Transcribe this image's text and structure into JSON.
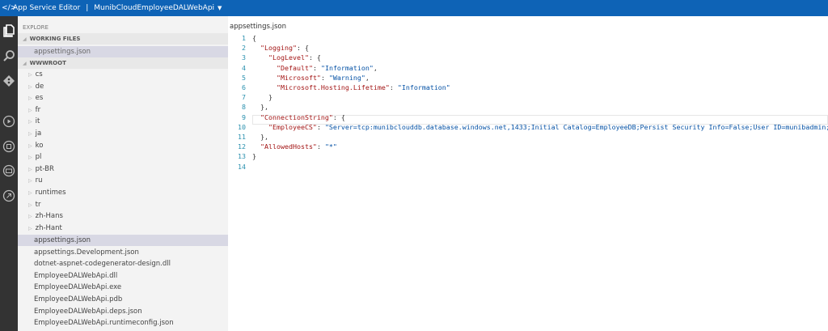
{
  "titlebar": {
    "app": "App Service Editor",
    "separator": "|",
    "site": "MunibCloudEmployeeDALWebApi"
  },
  "sidebar": {
    "explore": "EXPLORE",
    "working_files": "WORKING FILES",
    "working_items": [
      "appsettings.json"
    ],
    "root": "WWWROOT",
    "folders": [
      "cs",
      "de",
      "es",
      "fr",
      "it",
      "ja",
      "ko",
      "pl",
      "pt-BR",
      "ru",
      "runtimes",
      "tr",
      "zh-Hans",
      "zh-Hant"
    ],
    "files": [
      "appsettings.json",
      "appsettings.Development.json",
      "dotnet-aspnet-codegenerator-design.dll",
      "EmployeeDALWebApi.dll",
      "EmployeeDALWebApi.exe",
      "EmployeeDALWebApi.pdb",
      "EmployeeDALWebApi.deps.json",
      "EmployeeDALWebApi.runtimeconfig.json"
    ]
  },
  "editor": {
    "title": "appsettings.json",
    "lines": [
      [
        [
          "p",
          "{"
        ]
      ],
      [
        [
          "p",
          "  "
        ],
        [
          "k",
          "\"Logging\""
        ],
        [
          "p",
          ": {"
        ]
      ],
      [
        [
          "p",
          "    "
        ],
        [
          "k",
          "\"LogLevel\""
        ],
        [
          "p",
          ": {"
        ]
      ],
      [
        [
          "p",
          "      "
        ],
        [
          "k",
          "\"Default\""
        ],
        [
          "p",
          ": "
        ],
        [
          "s",
          "\"Information\""
        ],
        [
          "p",
          ","
        ]
      ],
      [
        [
          "p",
          "      "
        ],
        [
          "k",
          "\"Microsoft\""
        ],
        [
          "p",
          ": "
        ],
        [
          "s",
          "\"Warning\""
        ],
        [
          "p",
          ","
        ]
      ],
      [
        [
          "p",
          "      "
        ],
        [
          "k",
          "\"Microsoft.Hosting.Lifetime\""
        ],
        [
          "p",
          ": "
        ],
        [
          "s",
          "\"Information\""
        ]
      ],
      [
        [
          "p",
          "    }"
        ]
      ],
      [
        [
          "p",
          "  },"
        ]
      ],
      [
        [
          "p",
          "  "
        ],
        [
          "k",
          "\"ConnectionString\""
        ],
        [
          "p",
          ": {"
        ]
      ],
      [
        [
          "p",
          "    "
        ],
        [
          "k",
          "\"EmployeeCS\""
        ],
        [
          "p",
          ": "
        ],
        [
          "s",
          "\"Server=tcp:munibclouddb.database.windows.net,1433;Initial Catalog=EmployeeDB;Persist Security Info=False;User ID=munibadmin;Password="
        ]
      ],
      [
        [
          "p",
          "  },"
        ]
      ],
      [
        [
          "p",
          "  "
        ],
        [
          "k",
          "\"AllowedHosts\""
        ],
        [
          "p",
          ": "
        ],
        [
          "s",
          "\"*\""
        ]
      ],
      [
        [
          "p",
          "}"
        ]
      ],
      [
        [
          "p",
          ""
        ]
      ]
    ]
  }
}
